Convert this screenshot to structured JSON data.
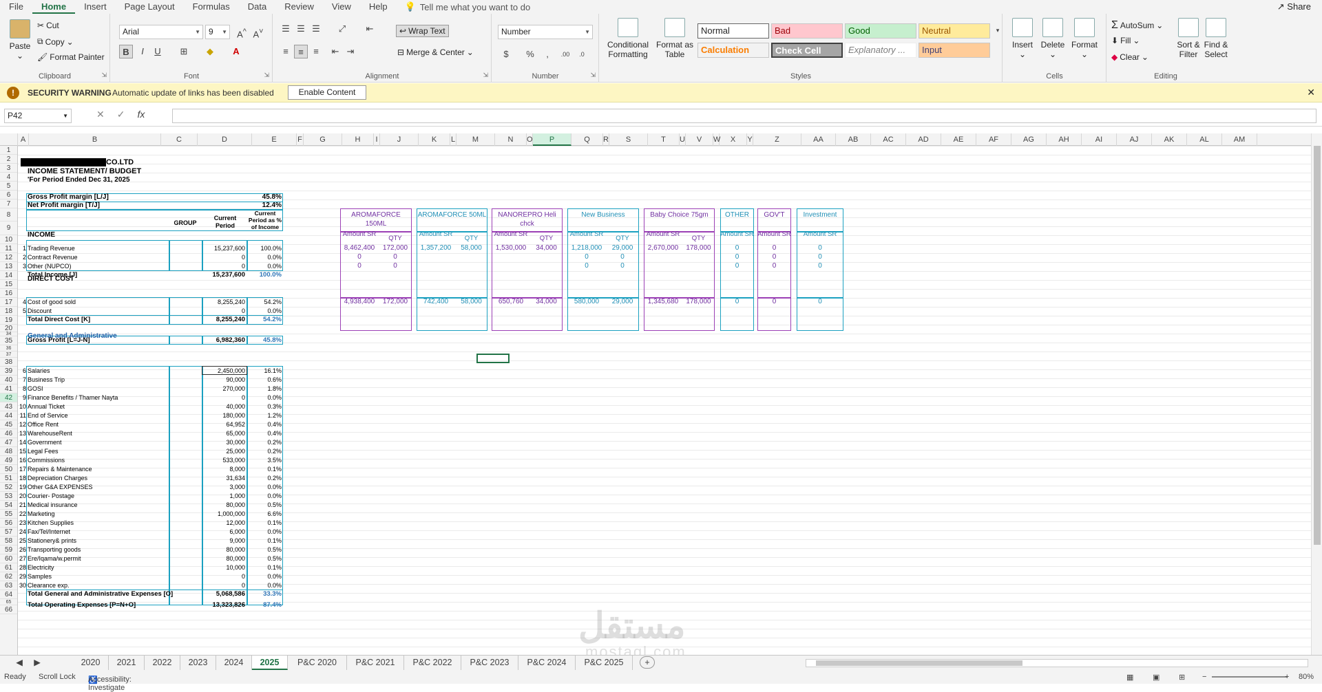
{
  "menu": {
    "tabs": [
      "File",
      "Home",
      "Insert",
      "Page Layout",
      "Formulas",
      "Data",
      "Review",
      "View",
      "Help"
    ],
    "tell": "Tell me what you want to do",
    "share": "Share"
  },
  "ribbon": {
    "clipboard": {
      "paste": "Paste",
      "cut": "Cut",
      "copy": "Copy",
      "painter": "Format Painter",
      "label": "Clipboard"
    },
    "font": {
      "name": "Arial",
      "size": "9",
      "label": "Font"
    },
    "alignment": {
      "wrap": "Wrap Text",
      "merge": "Merge & Center",
      "label": "Alignment"
    },
    "number": {
      "format": "Number",
      "label": "Number",
      "pct": "%",
      "comma": ",",
      "currency": "$"
    },
    "styles": {
      "cond": "Conditional Formatting",
      "table": "Format as Table",
      "normal": "Normal",
      "bad": "Bad",
      "good": "Good",
      "neutral": "Neutral",
      "calc": "Calculation",
      "check": "Check Cell",
      "explan": "Explanatory ...",
      "input": "Input",
      "label": "Styles"
    },
    "cells": {
      "insert": "Insert",
      "delete": "Delete",
      "format": "Format",
      "label": "Cells"
    },
    "editing": {
      "autosum": "AutoSum",
      "fill": "Fill",
      "clear": "Clear",
      "sort": "Sort & Filter",
      "find": "Find & Select",
      "label": "Editing"
    }
  },
  "security": {
    "title": "SECURITY WARNING",
    "message": "Automatic update of links has been disabled",
    "button": "Enable Content"
  },
  "formula": {
    "namebox": "P42",
    "fx": "fx",
    "value": ""
  },
  "columns": [
    "A",
    "B",
    "C",
    "D",
    "E",
    "F",
    "G",
    "H",
    "I",
    "J",
    "K",
    "L",
    "M",
    "N",
    "O",
    "P",
    "Q",
    "R",
    "S",
    "T",
    "U",
    "V",
    "W",
    "X",
    "Y",
    "Z",
    "AA",
    "AB",
    "AC",
    "AD",
    "AE",
    "AF",
    "AG",
    "AH",
    "AI",
    "AJ",
    "AK",
    "AL",
    "AM"
  ],
  "rows": [
    "1",
    "2",
    "3",
    "4",
    "5",
    "6",
    "7",
    "8",
    "9",
    "10",
    "11",
    "12",
    "13",
    "14",
    "15",
    "16",
    "17",
    "18",
    "19",
    "20",
    "34",
    "35",
    "36",
    "37",
    "38",
    "39",
    "40",
    "41",
    "42",
    "43",
    "44",
    "45",
    "46",
    "47",
    "48",
    "49",
    "50",
    "51",
    "52",
    "53",
    "54",
    "55",
    "56",
    "57",
    "58",
    "59",
    "60",
    "61",
    "62",
    "63",
    "64",
    "65",
    "66"
  ],
  "sheet": {
    "company": "CO.LTD",
    "title": "INCOME STATEMENT/ BUDGET",
    "period": "'For Period Ended Dec 31, 2025",
    "gpm_label": "Gross Profit margin  [L/J]",
    "gpm": "45.8%",
    "npm_label": "Net Profit margin  [T/J]",
    "npm": "12.4%",
    "hdr_group": "GROUP",
    "hdr_current": "Current Period",
    "hdr_pct": "Current Period as % of Income",
    "income": "INCOME",
    "income_rows": [
      {
        "n": "1",
        "label": "Trading Revenue",
        "val": "15,237,600",
        "pct": "100.0%"
      },
      {
        "n": "2",
        "label": "Contract Revenue",
        "val": "0",
        "pct": "0.0%"
      },
      {
        "n": "3",
        "label": "Other (NUPCO)",
        "val": "0",
        "pct": "0.0%"
      }
    ],
    "total_income": {
      "label": "Total Income  [J]",
      "val": "15,237,600",
      "pct": "100.0%"
    },
    "direct": "DIRECT COST",
    "direct_rows": [
      {
        "n": "4",
        "label": "Cost of good sold",
        "val": "8,255,240",
        "pct": "54.2%"
      },
      {
        "n": "5",
        "label": "Discount",
        "val": "0",
        "pct": "0.0%"
      }
    ],
    "total_direct": {
      "label": "Total Direct Cost  [K]",
      "val": "8,255,240",
      "pct": "54.2%"
    },
    "gross": {
      "label": "Gross Profit  [L=J-N]",
      "val": "6,982,360",
      "pct": "45.8%"
    },
    "ga": "General and Administrative",
    "ga_rows": [
      {
        "n": "6",
        "label": "Salaries",
        "val": "2,450,000",
        "pct": "16.1%"
      },
      {
        "n": "7",
        "label": "Business Trip",
        "val": "90,000",
        "pct": "0.6%"
      },
      {
        "n": "8",
        "label": "GOSI",
        "val": "270,000",
        "pct": "1.8%"
      },
      {
        "n": "9",
        "label": "Finance Benefits / Thamer Nayta",
        "val": "0",
        "pct": "0.0%"
      },
      {
        "n": "10",
        "label": "Annual Ticket",
        "val": "40,000",
        "pct": "0.3%"
      },
      {
        "n": "11",
        "label": "End of Service",
        "val": "180,000",
        "pct": "1.2%"
      },
      {
        "n": "12",
        "label": "Office Rent",
        "val": "64,952",
        "pct": "0.4%"
      },
      {
        "n": "13",
        "label": "WarehouseRent",
        "val": "65,000",
        "pct": "0.4%"
      },
      {
        "n": "14",
        "label": "Government",
        "val": "30,000",
        "pct": "0.2%"
      },
      {
        "n": "15",
        "label": "Legal Fees",
        "val": "25,000",
        "pct": "0.2%"
      },
      {
        "n": "16",
        "label": "Commissions",
        "val": "533,000",
        "pct": "3.5%"
      },
      {
        "n": "17",
        "label": "Repairs & Maintenance",
        "val": "8,000",
        "pct": "0.1%"
      },
      {
        "n": "18",
        "label": "Depreciation Charges",
        "val": "31,634",
        "pct": "0.2%"
      },
      {
        "n": "19",
        "label": "Other G&A EXPENSES",
        "val": "3,000",
        "pct": "0.0%"
      },
      {
        "n": "20",
        "label": "Courier- Postage",
        "val": "1,000",
        "pct": "0.0%"
      },
      {
        "n": "21",
        "label": "Medical insurance",
        "val": "80,000",
        "pct": "0.5%"
      },
      {
        "n": "22",
        "label": "Marketing",
        "val": "1,000,000",
        "pct": "6.6%"
      },
      {
        "n": "23",
        "label": "Kitchen Supplies",
        "val": "12,000",
        "pct": "0.1%"
      },
      {
        "n": "24",
        "label": "Fax/Tel/Internet",
        "val": "6,000",
        "pct": "0.0%"
      },
      {
        "n": "25",
        "label": "Stationery& prints",
        "val": "9,000",
        "pct": "0.1%"
      },
      {
        "n": "26",
        "label": "Transporting goods",
        "val": "80,000",
        "pct": "0.5%"
      },
      {
        "n": "27",
        "label": "Ere/Iqama/w.permit",
        "val": "80,000",
        "pct": "0.5%"
      },
      {
        "n": "28",
        "label": "Electricity",
        "val": "10,000",
        "pct": "0.1%"
      },
      {
        "n": "29",
        "label": "Samples",
        "val": "0",
        "pct": "0.0%"
      },
      {
        "n": "30",
        "label": "Clearance exp.",
        "val": "0",
        "pct": "0.0%"
      }
    ],
    "total_ga": {
      "label": "Total General and Administrative Expenses  [O]",
      "val": "5,068,586",
      "pct": "33.3%"
    },
    "total_opex": {
      "label": "Total Operating Expenses  [P=N+O]",
      "val": "13,323,826",
      "pct": "87.4%"
    },
    "segments": [
      {
        "name": "AROMAFORCE 150ML",
        "amt_hdr": "Amount SR",
        "qty_hdr": "QTY",
        "r11": [
          "8,462,400",
          "172,000"
        ],
        "r12": [
          "0",
          "0"
        ],
        "r13": [
          "0",
          "0"
        ],
        "r17": [
          "4,938,400",
          "172,000"
        ],
        "color": "purple"
      },
      {
        "name": "AROMAFORCE 50ML",
        "amt_hdr": "Amount SR",
        "qty_hdr": "QTY",
        "r11": [
          "1,357,200",
          "58,000"
        ],
        "r12": [
          "",
          ""
        ],
        "r13": [
          "",
          ""
        ],
        "r17": [
          "742,400",
          "58,000"
        ],
        "color": "teal"
      },
      {
        "name": "NANOREPRO Heli chck",
        "amt_hdr": "Amount SR",
        "qty_hdr": "QTY",
        "r11": [
          "1,530,000",
          "34,000"
        ],
        "r12": [
          "",
          ""
        ],
        "r13": [
          "",
          ""
        ],
        "r17": [
          "650,760",
          "34,000"
        ],
        "color": "purple"
      },
      {
        "name": "New Business",
        "amt_hdr": "Amount SR",
        "qty_hdr": "QTY",
        "r11": [
          "1,218,000",
          "29,000"
        ],
        "r12": [
          "0",
          "0"
        ],
        "r13": [
          "0",
          "0"
        ],
        "r17": [
          "580,000",
          "29,000"
        ],
        "color": "teal"
      },
      {
        "name": "Baby Choice 75gm",
        "amt_hdr": "Amount SR",
        "qty_hdr": "QTY",
        "r11": [
          "2,670,000",
          "178,000"
        ],
        "r12": [
          "",
          ""
        ],
        "r13": [
          "",
          ""
        ],
        "r17": [
          "1,345,680",
          "178,000"
        ],
        "color": "purple"
      },
      {
        "name": "OTHER",
        "amt_hdr": "Amount SR",
        "qty_hdr": "",
        "r11": [
          "0",
          ""
        ],
        "r12": [
          "0",
          ""
        ],
        "r13": [
          "0",
          ""
        ],
        "r17": [
          "0",
          ""
        ],
        "color": "teal"
      },
      {
        "name": "GOV'T",
        "amt_hdr": "Amount SR",
        "qty_hdr": "",
        "r11": [
          "0",
          ""
        ],
        "r12": [
          "0",
          ""
        ],
        "r13": [
          "0",
          ""
        ],
        "r17": [
          "0",
          ""
        ],
        "color": "purple"
      },
      {
        "name": "Investment",
        "amt_hdr": "Amount  SR",
        "qty_hdr": "",
        "r11": [
          "0",
          ""
        ],
        "r12": [
          "0",
          ""
        ],
        "r13": [
          "0",
          ""
        ],
        "r17": [
          "0",
          ""
        ],
        "color": "teal"
      }
    ]
  },
  "sheets": [
    "2020",
    "2021",
    "2022",
    "2023",
    "2024",
    "2025",
    "P&C 2020",
    "P&C 2021",
    "P&C 2022",
    "P&C 2023",
    "P&C 2024",
    "P&C 2025"
  ],
  "active_sheet": "2025",
  "status": {
    "ready": "Ready",
    "scroll": "Scroll Lock",
    "access": "Accessibility: Investigate",
    "zoom": "80%"
  },
  "watermark": {
    "arabic": "مستقل",
    "latin": "mostaql.com"
  },
  "colors": {
    "accent": "#217346",
    "teal": "#1f8eb5",
    "purple": "#7030a0"
  }
}
